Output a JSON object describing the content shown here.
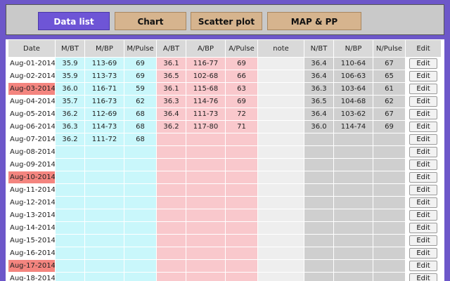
{
  "tabs": [
    {
      "label": "Data list",
      "active": true
    },
    {
      "label": "Chart",
      "active": false
    },
    {
      "label": "Scatter plot",
      "active": false
    },
    {
      "label": "MAP & PP",
      "active": false
    }
  ],
  "columns": [
    "Date",
    "M/BT",
    "M/BP",
    "M/Pulse",
    "A/BT",
    "A/BP",
    "A/Pulse",
    "note",
    "N/BT",
    "N/BP",
    "N/Pulse",
    "Edit"
  ],
  "edit_label": "Edit",
  "colors": {
    "background": "#6d57c9",
    "tab_active": "#6e55d6",
    "tab_inactive": "#d6b48e",
    "morning": "#c9f7fb",
    "afternoon": "#f9c8cc",
    "note": "#eeeeee",
    "night": "#cfcfcf",
    "highlight_date": "#f4857f"
  },
  "rows": [
    {
      "date": "Aug-01-2014",
      "highlight": false,
      "m_bt": "35.9",
      "m_bp": "113-69",
      "m_pulse": "69",
      "a_bt": "36.1",
      "a_bp": "116-77",
      "a_pulse": "69",
      "note": "",
      "n_bt": "36.4",
      "n_bp": "110-64",
      "n_pulse": "67"
    },
    {
      "date": "Aug-02-2014",
      "highlight": false,
      "m_bt": "35.9",
      "m_bp": "113-73",
      "m_pulse": "69",
      "a_bt": "36.5",
      "a_bp": "102-68",
      "a_pulse": "66",
      "note": "",
      "n_bt": "36.4",
      "n_bp": "106-63",
      "n_pulse": "65"
    },
    {
      "date": "Aug-03-2014",
      "highlight": true,
      "m_bt": "36.0",
      "m_bp": "116-71",
      "m_pulse": "59",
      "a_bt": "36.1",
      "a_bp": "115-68",
      "a_pulse": "63",
      "note": "",
      "n_bt": "36.3",
      "n_bp": "103-64",
      "n_pulse": "61"
    },
    {
      "date": "Aug-04-2014",
      "highlight": false,
      "m_bt": "35.7",
      "m_bp": "116-73",
      "m_pulse": "62",
      "a_bt": "36.3",
      "a_bp": "114-76",
      "a_pulse": "69",
      "note": "",
      "n_bt": "36.5",
      "n_bp": "104-68",
      "n_pulse": "62"
    },
    {
      "date": "Aug-05-2014",
      "highlight": false,
      "m_bt": "36.2",
      "m_bp": "112-69",
      "m_pulse": "68",
      "a_bt": "36.4",
      "a_bp": "111-73",
      "a_pulse": "72",
      "note": "",
      "n_bt": "36.4",
      "n_bp": "103-62",
      "n_pulse": "67"
    },
    {
      "date": "Aug-06-2014",
      "highlight": false,
      "m_bt": "36.3",
      "m_bp": "114-73",
      "m_pulse": "68",
      "a_bt": "36.2",
      "a_bp": "117-80",
      "a_pulse": "71",
      "note": "",
      "n_bt": "36.0",
      "n_bp": "114-74",
      "n_pulse": "69"
    },
    {
      "date": "Aug-07-2014",
      "highlight": false,
      "m_bt": "36.2",
      "m_bp": "111-72",
      "m_pulse": "68",
      "a_bt": "",
      "a_bp": "",
      "a_pulse": "",
      "note": "",
      "n_bt": "",
      "n_bp": "",
      "n_pulse": ""
    },
    {
      "date": "Aug-08-2014",
      "highlight": false,
      "m_bt": "",
      "m_bp": "",
      "m_pulse": "",
      "a_bt": "",
      "a_bp": "",
      "a_pulse": "",
      "note": "",
      "n_bt": "",
      "n_bp": "",
      "n_pulse": ""
    },
    {
      "date": "Aug-09-2014",
      "highlight": false,
      "m_bt": "",
      "m_bp": "",
      "m_pulse": "",
      "a_bt": "",
      "a_bp": "",
      "a_pulse": "",
      "note": "",
      "n_bt": "",
      "n_bp": "",
      "n_pulse": ""
    },
    {
      "date": "Aug-10-2014",
      "highlight": true,
      "m_bt": "",
      "m_bp": "",
      "m_pulse": "",
      "a_bt": "",
      "a_bp": "",
      "a_pulse": "",
      "note": "",
      "n_bt": "",
      "n_bp": "",
      "n_pulse": ""
    },
    {
      "date": "Aug-11-2014",
      "highlight": false,
      "m_bt": "",
      "m_bp": "",
      "m_pulse": "",
      "a_bt": "",
      "a_bp": "",
      "a_pulse": "",
      "note": "",
      "n_bt": "",
      "n_bp": "",
      "n_pulse": ""
    },
    {
      "date": "Aug-12-2014",
      "highlight": false,
      "m_bt": "",
      "m_bp": "",
      "m_pulse": "",
      "a_bt": "",
      "a_bp": "",
      "a_pulse": "",
      "note": "",
      "n_bt": "",
      "n_bp": "",
      "n_pulse": ""
    },
    {
      "date": "Aug-13-2014",
      "highlight": false,
      "m_bt": "",
      "m_bp": "",
      "m_pulse": "",
      "a_bt": "",
      "a_bp": "",
      "a_pulse": "",
      "note": "",
      "n_bt": "",
      "n_bp": "",
      "n_pulse": ""
    },
    {
      "date": "Aug-14-2014",
      "highlight": false,
      "m_bt": "",
      "m_bp": "",
      "m_pulse": "",
      "a_bt": "",
      "a_bp": "",
      "a_pulse": "",
      "note": "",
      "n_bt": "",
      "n_bp": "",
      "n_pulse": ""
    },
    {
      "date": "Aug-15-2014",
      "highlight": false,
      "m_bt": "",
      "m_bp": "",
      "m_pulse": "",
      "a_bt": "",
      "a_bp": "",
      "a_pulse": "",
      "note": "",
      "n_bt": "",
      "n_bp": "",
      "n_pulse": ""
    },
    {
      "date": "Aug-16-2014",
      "highlight": false,
      "m_bt": "",
      "m_bp": "",
      "m_pulse": "",
      "a_bt": "",
      "a_bp": "",
      "a_pulse": "",
      "note": "",
      "n_bt": "",
      "n_bp": "",
      "n_pulse": ""
    },
    {
      "date": "Aug-17-2014",
      "highlight": true,
      "m_bt": "",
      "m_bp": "",
      "m_pulse": "",
      "a_bt": "",
      "a_bp": "",
      "a_pulse": "",
      "note": "",
      "n_bt": "",
      "n_bp": "",
      "n_pulse": ""
    },
    {
      "date": "Aug-18-2014",
      "highlight": false,
      "m_bt": "",
      "m_bp": "",
      "m_pulse": "",
      "a_bt": "",
      "a_bp": "",
      "a_pulse": "",
      "note": "",
      "n_bt": "",
      "n_bp": "",
      "n_pulse": ""
    }
  ]
}
